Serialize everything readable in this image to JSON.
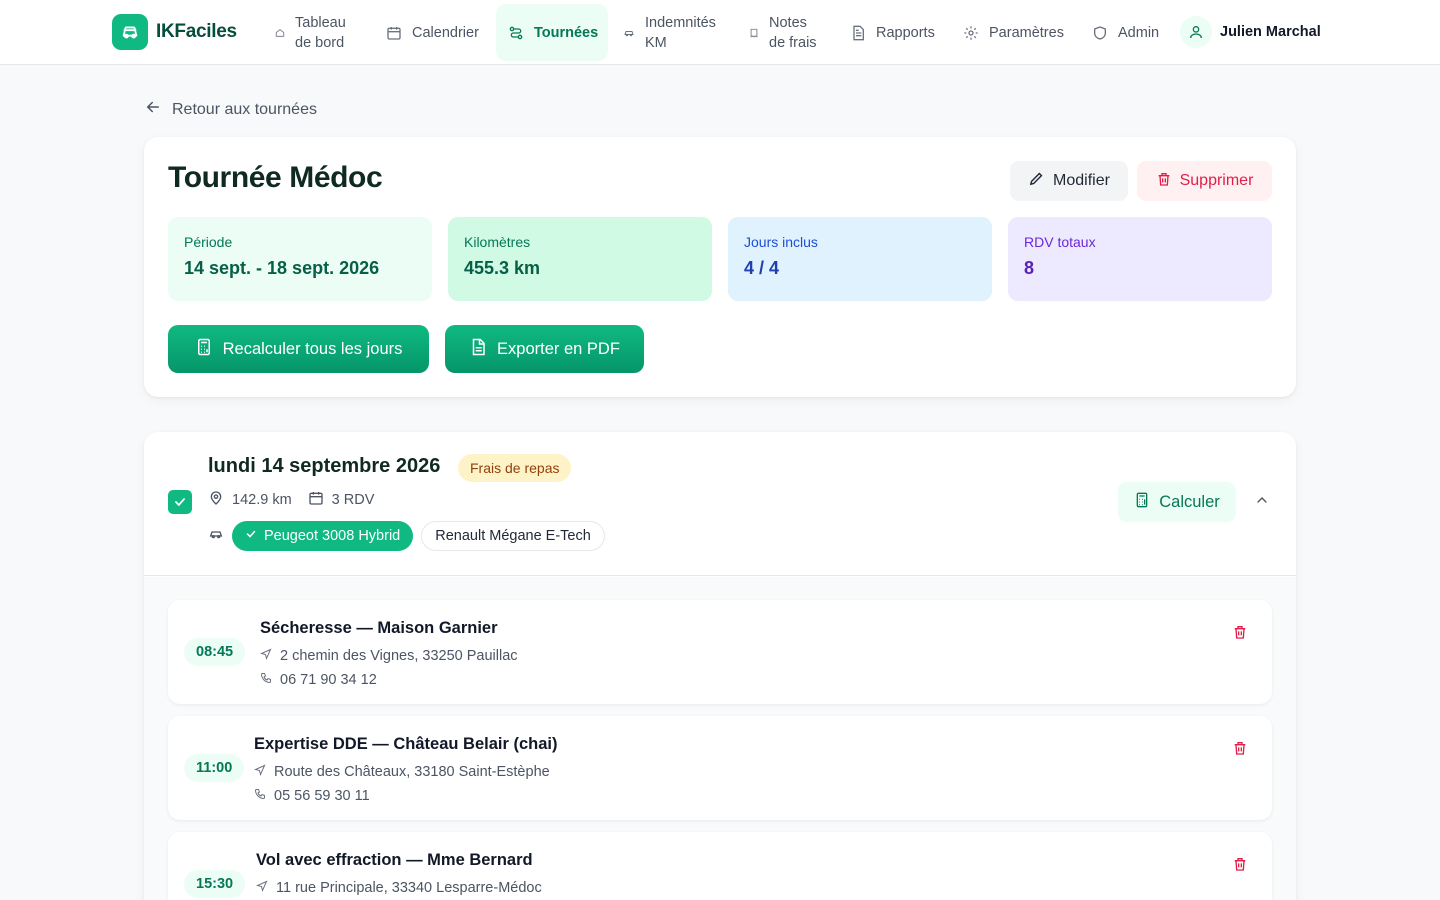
{
  "app": {
    "brand": "IKFaciles"
  },
  "nav": {
    "items": [
      {
        "label": "Tableau\nde bord",
        "icon": "home-icon"
      },
      {
        "label": "Calendrier",
        "icon": "calendar-icon"
      },
      {
        "label": "Tournées",
        "icon": "route-icon",
        "active": true
      },
      {
        "label": "Indemnités\nKM",
        "icon": "car-icon"
      },
      {
        "label": "Notes\nde frais",
        "icon": "receipt-icon"
      },
      {
        "label": "Rapports",
        "icon": "file-text-icon"
      },
      {
        "label": "Paramètres",
        "icon": "gear-icon"
      },
      {
        "label": "Admin",
        "icon": "shield-icon"
      }
    ],
    "user": "Julien Marchal"
  },
  "back_label": "Retour aux tournées",
  "tour": {
    "title": "Tournée Médoc",
    "edit_label": "Modifier",
    "delete_label": "Supprimer",
    "stats": [
      {
        "label": "Période",
        "value": "14 sept. - 18 sept. 2026"
      },
      {
        "label": "Kilomètres",
        "value": "455.3 km"
      },
      {
        "label": "Jours inclus",
        "value": "4 / 4"
      },
      {
        "label": "RDV totaux",
        "value": "8"
      }
    ],
    "recalc_label": "Recalculer tous les jours",
    "pdf_label": "Exporter en PDF"
  },
  "day": {
    "title": "lundi 14 septembre 2026",
    "tag": "Frais de repas",
    "km": "142.9 km",
    "rdv": "3 RDV",
    "vehicles": [
      {
        "label": "Peugeot 3008 Hybrid",
        "selected": true
      },
      {
        "label": "Renault Mégane E-Tech",
        "selected": false
      }
    ],
    "calc_label": "Calculer",
    "appointments": [
      {
        "time": "08:45",
        "title": "Sécheresse — Maison Garnier",
        "address": "2 chemin des Vignes, 33250 Pauillac",
        "phone": "06 71 90 34 12"
      },
      {
        "time": "11:00",
        "title": "Expertise DDE — Château Belair (chai)",
        "address": "Route des Châteaux, 33180 Saint-Estèphe",
        "phone": "05 56 59 30 11"
      },
      {
        "time": "15:30",
        "title": "Vol avec effraction — Mme Bernard",
        "address": "11 rue Principale, 33340 Lesparre-Médoc",
        "phone": ""
      }
    ]
  },
  "colors": {
    "accent": "#10b981",
    "danger": "#e11d48"
  }
}
